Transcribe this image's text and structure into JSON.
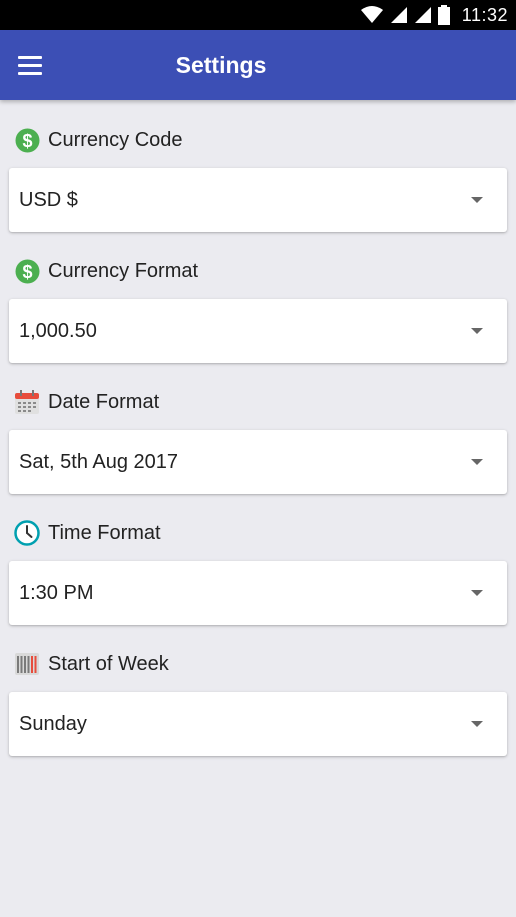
{
  "status_bar": {
    "time": "11:32"
  },
  "app_bar": {
    "title": "Settings"
  },
  "settings": [
    {
      "label": "Currency Code",
      "value": "USD $",
      "icon": "dollar-icon"
    },
    {
      "label": "Currency Format",
      "value": "1,000.50",
      "icon": "dollar-icon"
    },
    {
      "label": "Date Format",
      "value": "Sat, 5th Aug 2017",
      "icon": "calendar-icon"
    },
    {
      "label": "Time Format",
      "value": "1:30 PM",
      "icon": "clock-icon"
    },
    {
      "label": "Start of Week",
      "value": "Sunday",
      "icon": "week-icon"
    }
  ],
  "colors": {
    "app_bar": "#3c4fb5",
    "background": "#ebebf0",
    "dollar_icon": "#4caf50",
    "clock_icon": "#00a0b0",
    "calendar_icon": "#e74c3c"
  }
}
